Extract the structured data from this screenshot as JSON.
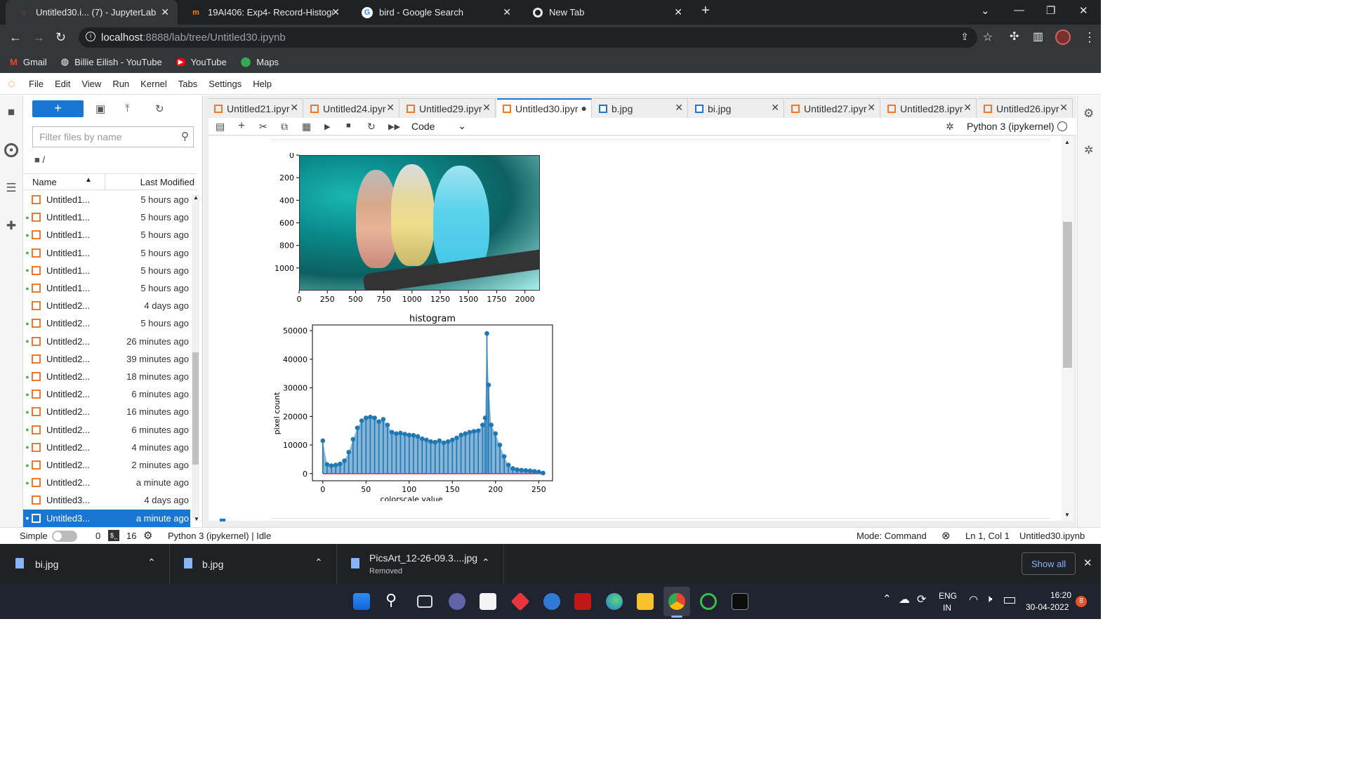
{
  "browser": {
    "tabs": [
      {
        "title": "Untitled30.i... (7) - JupyterLab",
        "icon": "jupyter-icon"
      },
      {
        "title": "19AI406: Exp4- Record-Histogran",
        "icon": "moodle-icon"
      },
      {
        "title": "bird - Google Search",
        "icon": "google-icon"
      },
      {
        "title": "New Tab",
        "icon": "chrome-icon"
      }
    ],
    "url_host": "localhost",
    "url_path": ":8888/lab/tree/Untitled30.ipynb",
    "bookmarks": [
      "Gmail",
      "Billie Eilish - YouTube",
      "YouTube",
      "Maps"
    ]
  },
  "jupyter": {
    "menus": [
      "File",
      "Edit",
      "View",
      "Run",
      "Kernel",
      "Tabs",
      "Settings",
      "Help"
    ],
    "filter_placeholder": "Filter files by name",
    "breadcrumb": "/",
    "col_name": "Name",
    "col_modified": "Last Modified",
    "files": [
      {
        "name": "Untitled1...",
        "modified": "5 hours ago",
        "running": false
      },
      {
        "name": "Untitled1...",
        "modified": "5 hours ago",
        "running": true
      },
      {
        "name": "Untitled1...",
        "modified": "5 hours ago",
        "running": true
      },
      {
        "name": "Untitled1...",
        "modified": "5 hours ago",
        "running": true
      },
      {
        "name": "Untitled1...",
        "modified": "5 hours ago",
        "running": true
      },
      {
        "name": "Untitled1...",
        "modified": "5 hours ago",
        "running": true
      },
      {
        "name": "Untitled2...",
        "modified": "4 days ago",
        "running": false
      },
      {
        "name": "Untitled2...",
        "modified": "5 hours ago",
        "running": true
      },
      {
        "name": "Untitled2...",
        "modified": "26 minutes ago",
        "running": true
      },
      {
        "name": "Untitled2...",
        "modified": "39 minutes ago",
        "running": false
      },
      {
        "name": "Untitled2...",
        "modified": "18 minutes ago",
        "running": true
      },
      {
        "name": "Untitled2...",
        "modified": "6 minutes ago",
        "running": true
      },
      {
        "name": "Untitled2...",
        "modified": "16 minutes ago",
        "running": true
      },
      {
        "name": "Untitled2...",
        "modified": "6 minutes ago",
        "running": true
      },
      {
        "name": "Untitled2...",
        "modified": "4 minutes ago",
        "running": true
      },
      {
        "name": "Untitled2...",
        "modified": "2 minutes ago",
        "running": true
      },
      {
        "name": "Untitled2...",
        "modified": "a minute ago",
        "running": true
      },
      {
        "name": "Untitled3...",
        "modified": "4 days ago",
        "running": false
      },
      {
        "name": "Untitled3...",
        "modified": "a minute ago",
        "running": true,
        "selected": true
      }
    ],
    "doc_tabs": [
      {
        "title": "Untitled21.ipyr",
        "kind": "notebook"
      },
      {
        "title": "Untitled24.ipyr",
        "kind": "notebook"
      },
      {
        "title": "Untitled29.ipyr",
        "kind": "notebook"
      },
      {
        "title": "Untitled30.ipyr",
        "kind": "notebook",
        "active": true
      },
      {
        "title": "b.jpg",
        "kind": "image"
      },
      {
        "title": "bi.jpg",
        "kind": "image"
      },
      {
        "title": "Untitled27.ipyr",
        "kind": "notebook"
      },
      {
        "title": "Untitled28.ipyr",
        "kind": "notebook"
      },
      {
        "title": "Untitled26.ipyr",
        "kind": "notebook"
      }
    ],
    "cell_type": "Code",
    "kernel_name": "Python 3 (ipykernel)",
    "status": {
      "mode_label": "Simple",
      "terminals": "0",
      "kernels": "16",
      "kernel_status": "Python 3 (ipykernel) | Idle",
      "mode": "Mode: Command",
      "cursor": "Ln 1, Col 1",
      "file": "Untitled30.ipynb"
    }
  },
  "image_plot": {
    "x_ticks": [
      "0",
      "250",
      "500",
      "750",
      "1000",
      "1250",
      "1500",
      "1750",
      "2000"
    ],
    "y_ticks": [
      "0",
      "200",
      "400",
      "600",
      "800",
      "1000"
    ]
  },
  "chart_data": {
    "type": "line",
    "title": "histogram",
    "xlabel": "colorscale value",
    "ylabel": "pixel count",
    "xlim": [
      -12,
      266
    ],
    "ylim": [
      -2500,
      52000
    ],
    "x_ticks": [
      "0",
      "50",
      "100",
      "150",
      "200",
      "250"
    ],
    "y_ticks": [
      "0",
      "10000",
      "20000",
      "30000",
      "40000",
      "50000"
    ],
    "x": [
      0,
      5,
      10,
      15,
      20,
      25,
      30,
      35,
      40,
      45,
      50,
      55,
      60,
      65,
      70,
      75,
      80,
      85,
      90,
      95,
      100,
      105,
      110,
      115,
      120,
      125,
      130,
      135,
      140,
      145,
      150,
      155,
      160,
      165,
      170,
      175,
      180,
      185,
      188,
      190,
      192,
      195,
      200,
      205,
      210,
      215,
      220,
      225,
      230,
      235,
      240,
      245,
      250,
      255
    ],
    "values": [
      11500,
      3200,
      2800,
      3000,
      3400,
      4500,
      7500,
      12000,
      16000,
      18500,
      19500,
      19800,
      19500,
      18200,
      19000,
      17000,
      14500,
      14000,
      14200,
      13800,
      13500,
      13400,
      13000,
      12200,
      11800,
      11200,
      11000,
      11500,
      10800,
      11200,
      11800,
      12500,
      13500,
      14000,
      14500,
      14800,
      15000,
      17000,
      19500,
      49000,
      31000,
      17000,
      14000,
      10000,
      6000,
      3000,
      1800,
      1400,
      1200,
      1100,
      1000,
      800,
      600,
      200
    ],
    "grid": false
  },
  "downloads": [
    {
      "name": "bi.jpg",
      "note": ""
    },
    {
      "name": "b.jpg",
      "note": ""
    },
    {
      "name": "PicsArt_12-26-09.3....jpg",
      "note": "Removed"
    }
  ],
  "downloads_show_all": "Show all",
  "taskbar": {
    "lang": "ENG",
    "region": "IN",
    "time": "16:20",
    "date": "30-04-2022",
    "notifications": "8"
  },
  "colors": {
    "chrome_dark": "#202124",
    "chrome_mid": "#35363a",
    "jupyter_blue": "#1976d2",
    "notebook_orange": "#f37726",
    "plot_blue": "#1f77b4",
    "baseline_red": "#d62728"
  }
}
